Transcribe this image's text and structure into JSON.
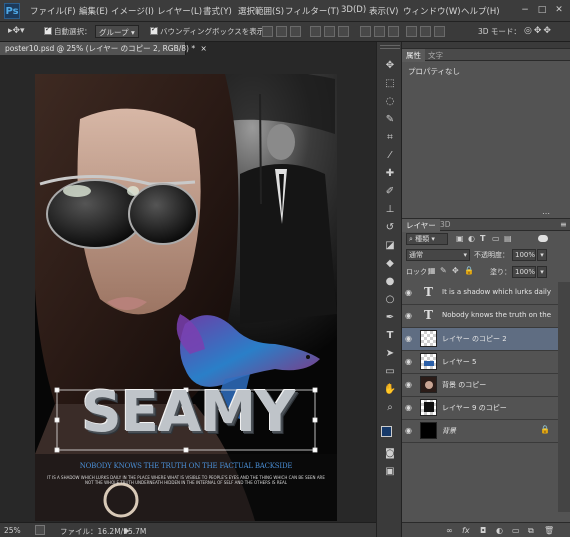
{
  "app": {
    "logo": "Ps",
    "window_controls": [
      "−",
      "□",
      "✕"
    ]
  },
  "menu": [
    "ファイル(F)",
    "編集(E)",
    "イメージ(I)",
    "レイヤー(L)",
    "書式(Y)",
    "選択範囲(S)",
    "フィルター(T)",
    "3D(D)",
    "表示(V)",
    "ウィンドウ(W)",
    "ヘルプ(H)"
  ],
  "options": {
    "auto_select_label": "自動選択：",
    "auto_select_value": "グループ",
    "bounding_box_label": "バウンディングボックスを表示",
    "mode_label": "3D モード："
  },
  "document": {
    "tab_title": "poster10.psd @ 25% (レイヤー のコピー 2, RGB/8) *",
    "tab_close": "×"
  },
  "poster": {
    "title": "SEAMY",
    "tagline": "NOBODY KNOWS THE TRUTH ON THE FACTUAL BACKSIDE",
    "body": "IT IS A SHADOW WHICH LURKS DAILY IN THE PLACE WHERE WHAT IS VISIBLE TO PEOPLE'S EYES AND THE THING WHICH CAN BE SEEN ARE NOT THE WHOLE TRUTH UNDERNEATH HIDDEN IN THE INTERNAL OF SELF AND THE OTHERS IS REAL"
  },
  "status": {
    "zoom": "25%",
    "file_info": "ファイル：16.2M/95.7M"
  },
  "properties": {
    "tabs": [
      "属性",
      "文字"
    ],
    "content": "プロパティなし"
  },
  "layers_panel": {
    "tabs": [
      "レイヤー",
      "3D"
    ],
    "filter_kind": "種類",
    "blend_mode": "通常",
    "opacity_label": "不透明度：",
    "opacity_value": "100%",
    "lock_label": "ロック：",
    "fill_label": "塗り：",
    "fill_value": "100%",
    "layers": [
      {
        "name": "It is a shadow which lurks daily ...",
        "type": "text",
        "selected": false
      },
      {
        "name": "Nobody knows the truth on the ...",
        "type": "text",
        "selected": false
      },
      {
        "name": "レイヤー のコピー 2",
        "type": "image",
        "selected": true
      },
      {
        "name": "レイヤー 5",
        "type": "image",
        "selected": false
      },
      {
        "name": "背景 のコピー",
        "type": "image",
        "selected": false
      },
      {
        "name": "レイヤー 9 のコピー",
        "type": "image",
        "selected": false
      },
      {
        "name": "背景",
        "type": "background",
        "selected": false
      }
    ],
    "footer_icons": [
      "link-icon",
      "fx-icon",
      "mask-icon",
      "adjustment-icon",
      "folder-icon",
      "new-layer-icon",
      "trash-icon"
    ]
  },
  "colors": {
    "accent": "#4a8fd6",
    "selected_layer": "#5f6d82",
    "panel": "#535353"
  }
}
